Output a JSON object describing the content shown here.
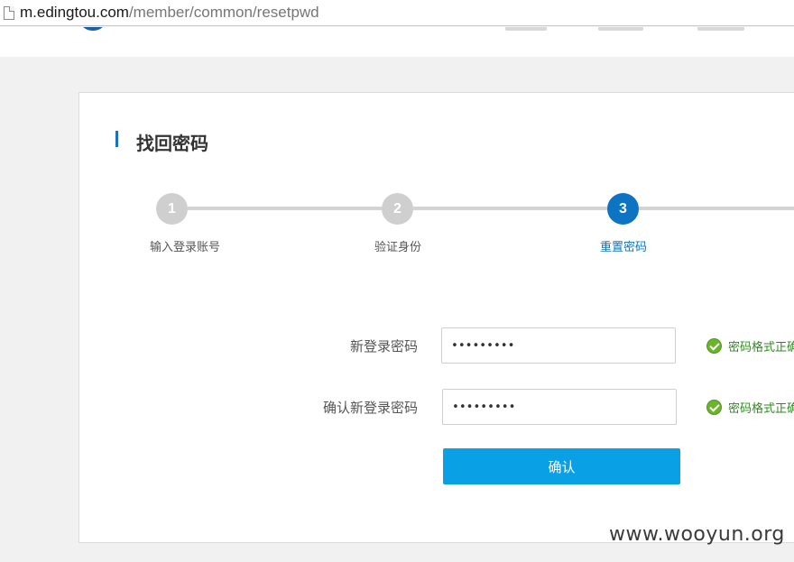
{
  "browser": {
    "url_host": "m.edingtou.com",
    "url_path": "/member/common/resetpwd"
  },
  "page": {
    "title": "找回密码"
  },
  "steps": [
    {
      "number": "1",
      "label": "输入登录账号",
      "active": false
    },
    {
      "number": "2",
      "label": "验证身份",
      "active": false
    },
    {
      "number": "3",
      "label": "重置密码",
      "active": true
    }
  ],
  "form": {
    "new_password_label": "新登录密码",
    "new_password_value": "•••••••••",
    "confirm_password_label": "确认新登录密码",
    "confirm_password_value": "•••••••••",
    "new_password_hint": "密码格式正确",
    "confirm_password_hint": "密码格式正确",
    "submit_label": "确认"
  },
  "watermark": "www.wooyun.org",
  "colors": {
    "accent": "#0d74c4",
    "button": "#0aa0e6",
    "success": "#2e8b1e",
    "inactive_step": "#cfcfcf"
  }
}
